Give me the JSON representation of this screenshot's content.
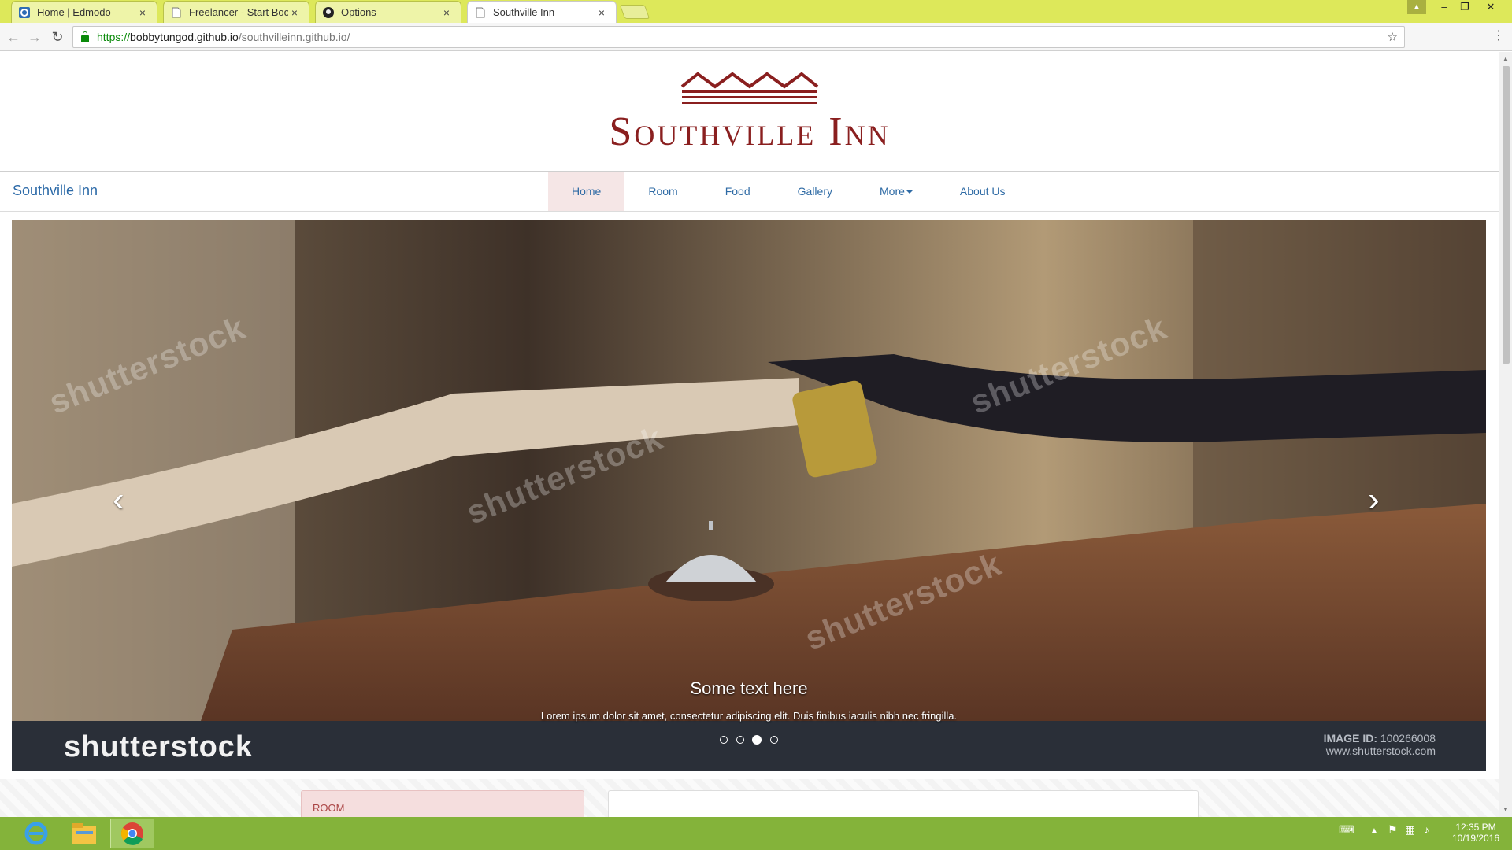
{
  "browser": {
    "tabs": [
      {
        "title": "Home | Edmodo",
        "icon": "edmodo-icon"
      },
      {
        "title": "Freelancer - Start Bootstr",
        "icon": "page-icon"
      },
      {
        "title": "Options",
        "icon": "github-icon"
      },
      {
        "title": "Southville Inn",
        "icon": "page-icon",
        "active": true
      }
    ],
    "url": {
      "scheme": "https://",
      "host": "bobbytungod.github.io",
      "path": "/southvilleinn.github.io/"
    },
    "window_controls": {
      "minimize": "–",
      "restore": "❐",
      "close": "✕"
    }
  },
  "site": {
    "logo_text": "Southville Inn",
    "brand_color": "#8a1f1f",
    "navbar": {
      "brand": "Southville Inn",
      "items": [
        {
          "label": "Home",
          "active": true
        },
        {
          "label": "Room"
        },
        {
          "label": "Food"
        },
        {
          "label": "Gallery"
        },
        {
          "label": "More"
        },
        {
          "label": "About Us"
        }
      ]
    },
    "carousel": {
      "caption_title": "Some text here",
      "caption_text": "Lorem ipsum dolor sit amet, consectetur adipiscing elit. Duis finibus iaculis nibh nec fringilla.",
      "indicator_count": 4,
      "active_indicator": 3,
      "watermark": "shutterstock",
      "stock_logo": "shutterstock",
      "image_id_label": "IMAGE ID:",
      "image_id": "100266008",
      "stock_url": "www.shutterstock.com",
      "prev_icon": "chevron-left-icon",
      "next_icon": "chevron-right-icon"
    },
    "below": {
      "room_label": "ROOM"
    }
  },
  "taskbar": {
    "apps": [
      "internet-explorer-icon",
      "file-explorer-icon",
      "chrome-icon"
    ],
    "clock_time": "12:35 PM",
    "clock_date": "10/19/2016"
  }
}
